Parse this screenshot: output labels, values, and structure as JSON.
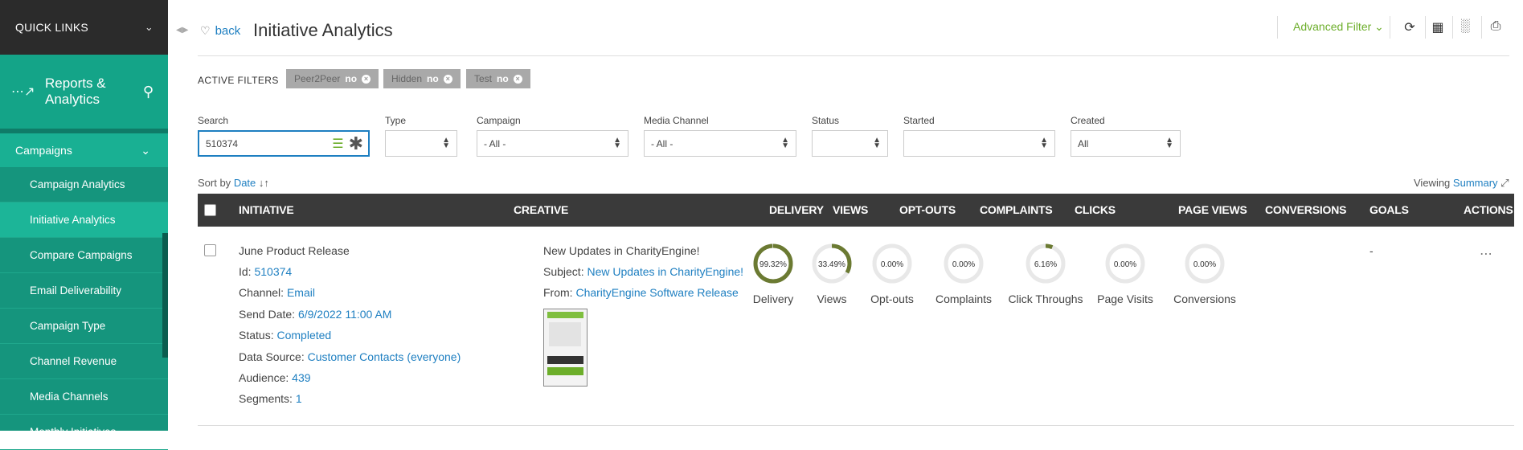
{
  "sidebar": {
    "quick_links": "QUICK LINKS",
    "section_title": "Reports & Analytics",
    "group": "Campaigns",
    "items": [
      {
        "label": "Campaign Analytics"
      },
      {
        "label": "Initiative Analytics"
      },
      {
        "label": "Compare Campaigns"
      },
      {
        "label": "Email Deliverability"
      },
      {
        "label": "Campaign Type"
      },
      {
        "label": "Channel Revenue"
      },
      {
        "label": "Media Channels"
      },
      {
        "label": "Monthly Initiatives"
      }
    ]
  },
  "header": {
    "back": "back",
    "title": "Initiative Analytics",
    "advanced_filter": "Advanced Filter"
  },
  "filters": {
    "active_label": "ACTIVE FILTERS",
    "chips": [
      {
        "name": "Peer2Peer",
        "value": "no"
      },
      {
        "name": "Hidden",
        "value": "no"
      },
      {
        "name": "Test",
        "value": "no"
      }
    ],
    "search_label": "Search",
    "search_value": "510374",
    "type_label": "Type",
    "type_value": "",
    "campaign_label": "Campaign",
    "campaign_value": "- All -",
    "media_label": "Media Channel",
    "media_value": "- All -",
    "status_label": "Status",
    "status_value": "",
    "started_label": "Started",
    "started_value": "",
    "created_label": "Created",
    "created_value": "All"
  },
  "sort": {
    "prefix": "Sort by",
    "field": "Date"
  },
  "viewing": {
    "prefix": "Viewing",
    "mode": "Summary"
  },
  "table": {
    "headers": [
      "INITIATIVE",
      "CREATIVE",
      "DELIVERY",
      "VIEWS",
      "OPT-OUTS",
      "COMPLAINTS",
      "CLICKS",
      "PAGE VIEWS",
      "CONVERSIONS",
      "GOALS",
      "ACTIONS"
    ],
    "row": {
      "initiative_name": "June Product Release",
      "id_label": "Id:",
      "id": "510374",
      "channel_label": "Channel:",
      "channel": "Email",
      "send_date_label": "Send Date:",
      "send_date": "6/9/2022 11:00 AM",
      "status_label": "Status:",
      "status": "Completed",
      "data_source_label": "Data Source:",
      "data_source": "Customer Contacts (everyone)",
      "audience_label": "Audience:",
      "audience": "439",
      "segments_label": "Segments:",
      "segments": "1",
      "creative_title": "New Updates in CharityEngine!",
      "subject_label": "Subject:",
      "subject": "New Updates in CharityEngine!",
      "from_label": "From:",
      "from": "CharityEngine Software Release",
      "goals": "-",
      "metrics": [
        {
          "label": "Delivery",
          "text": "99.32%",
          "value": 99.32
        },
        {
          "label": "Views",
          "text": "33.49%",
          "value": 33.49
        },
        {
          "label": "Opt-outs",
          "text": "0.00%",
          "value": 0
        },
        {
          "label": "Complaints",
          "text": "0.00%",
          "value": 0
        },
        {
          "label": "Click Throughs",
          "text": "6.16%",
          "value": 6.16
        },
        {
          "label": "Page Visits",
          "text": "0.00%",
          "value": 0
        },
        {
          "label": "Conversions",
          "text": "0.00%",
          "value": 0
        }
      ]
    }
  },
  "colors": {
    "accent": "#15957d",
    "link": "#1e7fc1",
    "gauge": "#6b7a32",
    "gauge_track": "#e8e8e8",
    "filter_green": "#6cae2a"
  }
}
